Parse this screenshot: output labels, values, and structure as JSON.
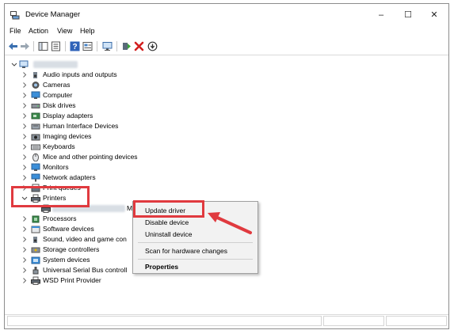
{
  "window": {
    "title": "Device Manager",
    "controls": {
      "minimize": "–",
      "maximize": "☐",
      "close": "✕"
    }
  },
  "menu": [
    "File",
    "Action",
    "View",
    "Help"
  ],
  "toolbar_icons": [
    "back-arrow-icon",
    "forward-arrow-icon",
    "show-hide-tree-icon",
    "properties-icon",
    "help-icon",
    "view-icon",
    "monitor-icon",
    "update-driver-icon",
    "uninstall-x-icon",
    "download-icon"
  ],
  "tree": {
    "root_label": "",
    "items": [
      {
        "label": "Audio inputs and outputs",
        "icon": "speaker-icon"
      },
      {
        "label": "Cameras",
        "icon": "camera-icon"
      },
      {
        "label": "Computer",
        "icon": "computer-icon"
      },
      {
        "label": "Disk drives",
        "icon": "disk-drive-icon"
      },
      {
        "label": "Display adapters",
        "icon": "display-adapter-icon"
      },
      {
        "label": "Human Interface Devices",
        "icon": "hid-icon"
      },
      {
        "label": "Imaging devices",
        "icon": "imaging-icon"
      },
      {
        "label": "Keyboards",
        "icon": "keyboard-icon"
      },
      {
        "label": "Mice and other pointing devices",
        "icon": "mouse-icon"
      },
      {
        "label": "Monitors",
        "icon": "monitor-icon"
      },
      {
        "label": "Network adapters",
        "icon": "network-icon"
      },
      {
        "label": "Print queues",
        "icon": "print-queue-icon"
      },
      {
        "label": "Printers",
        "icon": "printer-icon",
        "expanded": true
      },
      {
        "label": "",
        "icon": "printer-icon",
        "child": true,
        "suffix": "M"
      },
      {
        "label": "Processors",
        "icon": "processor-icon"
      },
      {
        "label": "Software devices",
        "icon": "software-icon"
      },
      {
        "label": "Sound, video and game con",
        "icon": "sound-icon"
      },
      {
        "label": "Storage controllers",
        "icon": "storage-icon"
      },
      {
        "label": "System devices",
        "icon": "system-icon"
      },
      {
        "label": "Universal Serial Bus controll",
        "icon": "usb-icon"
      },
      {
        "label": "WSD Print Provider",
        "icon": "printer-icon"
      }
    ]
  },
  "context_menu": {
    "items": [
      "Update driver",
      "Disable device",
      "Uninstall device"
    ],
    "scan": "Scan for hardware changes",
    "properties": "Properties"
  },
  "colors": {
    "highlight": "#e03a3f",
    "folder_blue": "#2b78c2"
  }
}
